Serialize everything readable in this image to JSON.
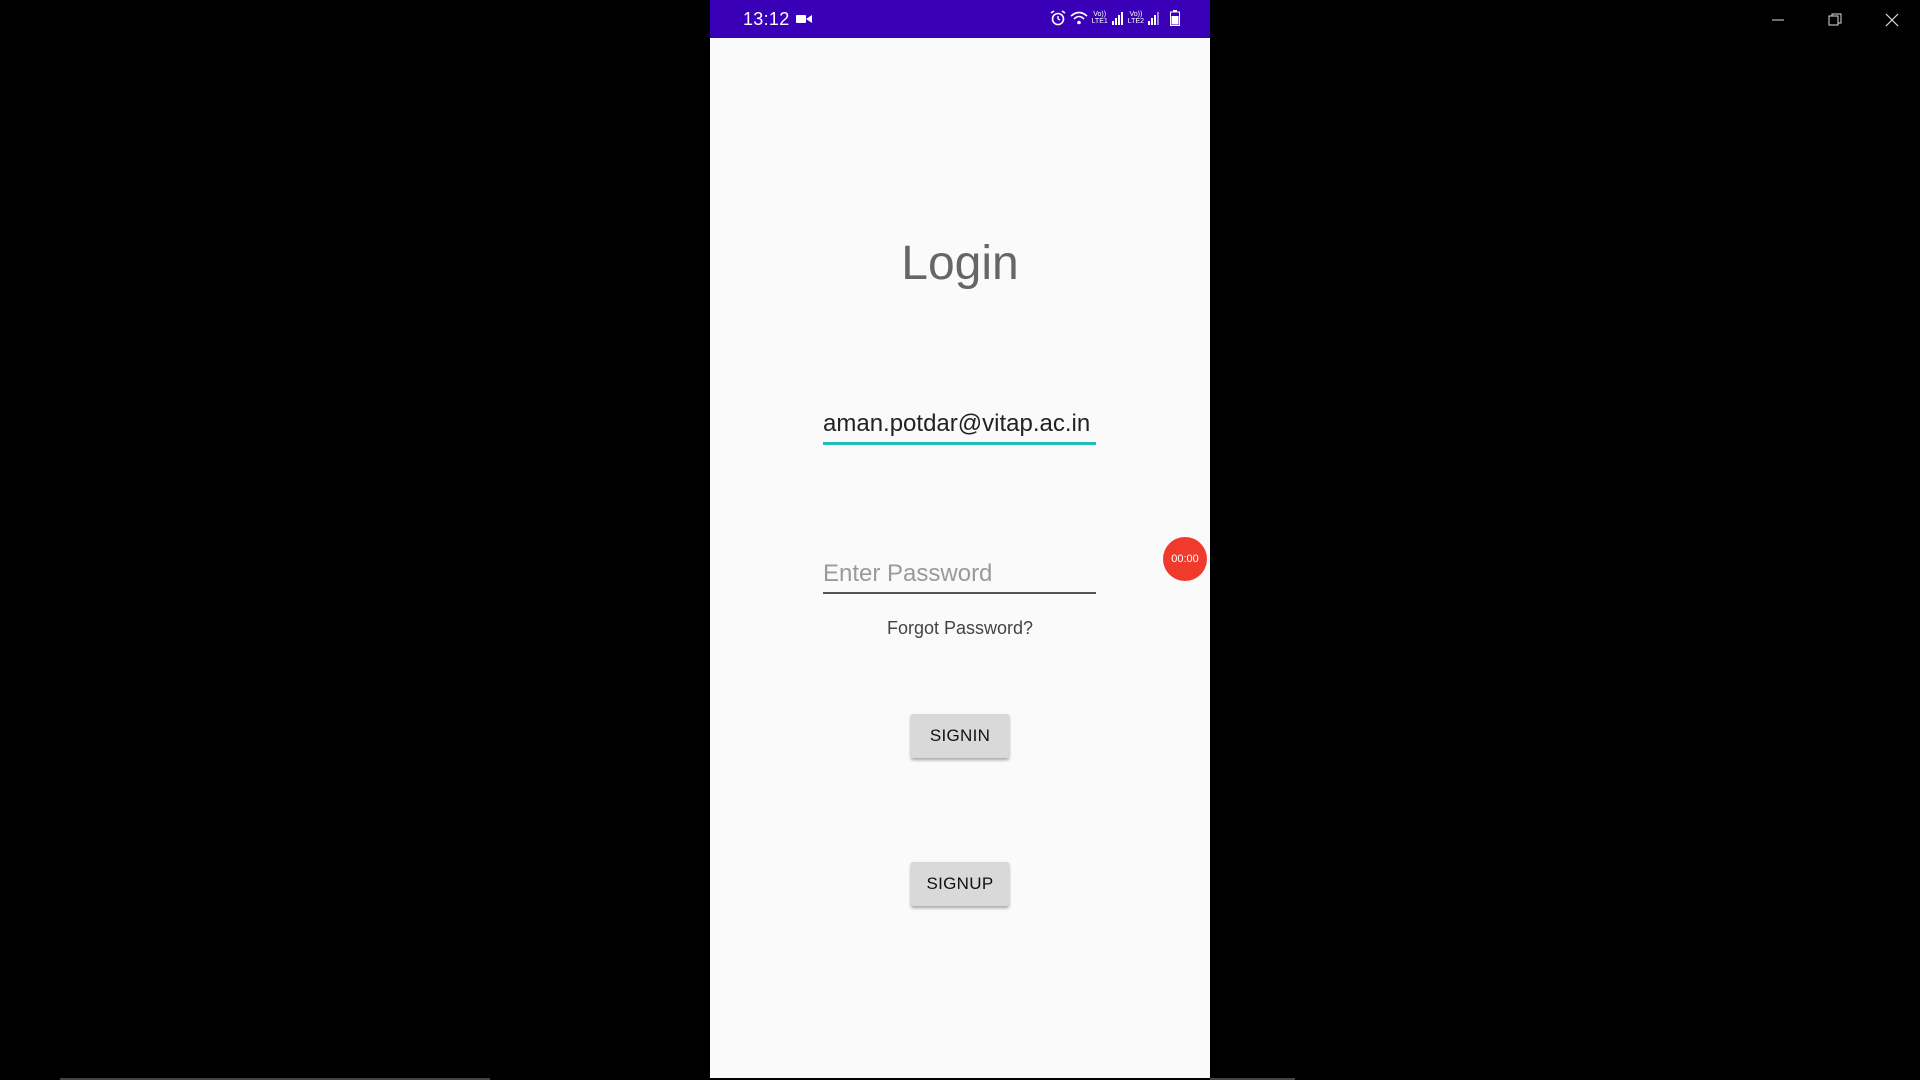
{
  "window": {
    "controls": [
      "minimize-icon",
      "restore-icon",
      "close-icon"
    ]
  },
  "statusbar": {
    "time": "13:12",
    "sim1": "LTE1",
    "sim2": "LTE2",
    "volte": "Vo))",
    "icons": [
      "video-camera-icon",
      "alarm-icon",
      "wifi-icon",
      "signal-icon",
      "battery-icon"
    ],
    "color": "#3a00b8"
  },
  "login": {
    "title": "Login",
    "email_value": "aman.potdar@vitap.ac.in",
    "password_placeholder": "Enter Password",
    "forgot_label": "Forgot Password?",
    "signin_label": "SIGNIN",
    "signup_label": "SIGNUP"
  },
  "recorder": {
    "time": "00:00",
    "color": "#f03a2c"
  }
}
